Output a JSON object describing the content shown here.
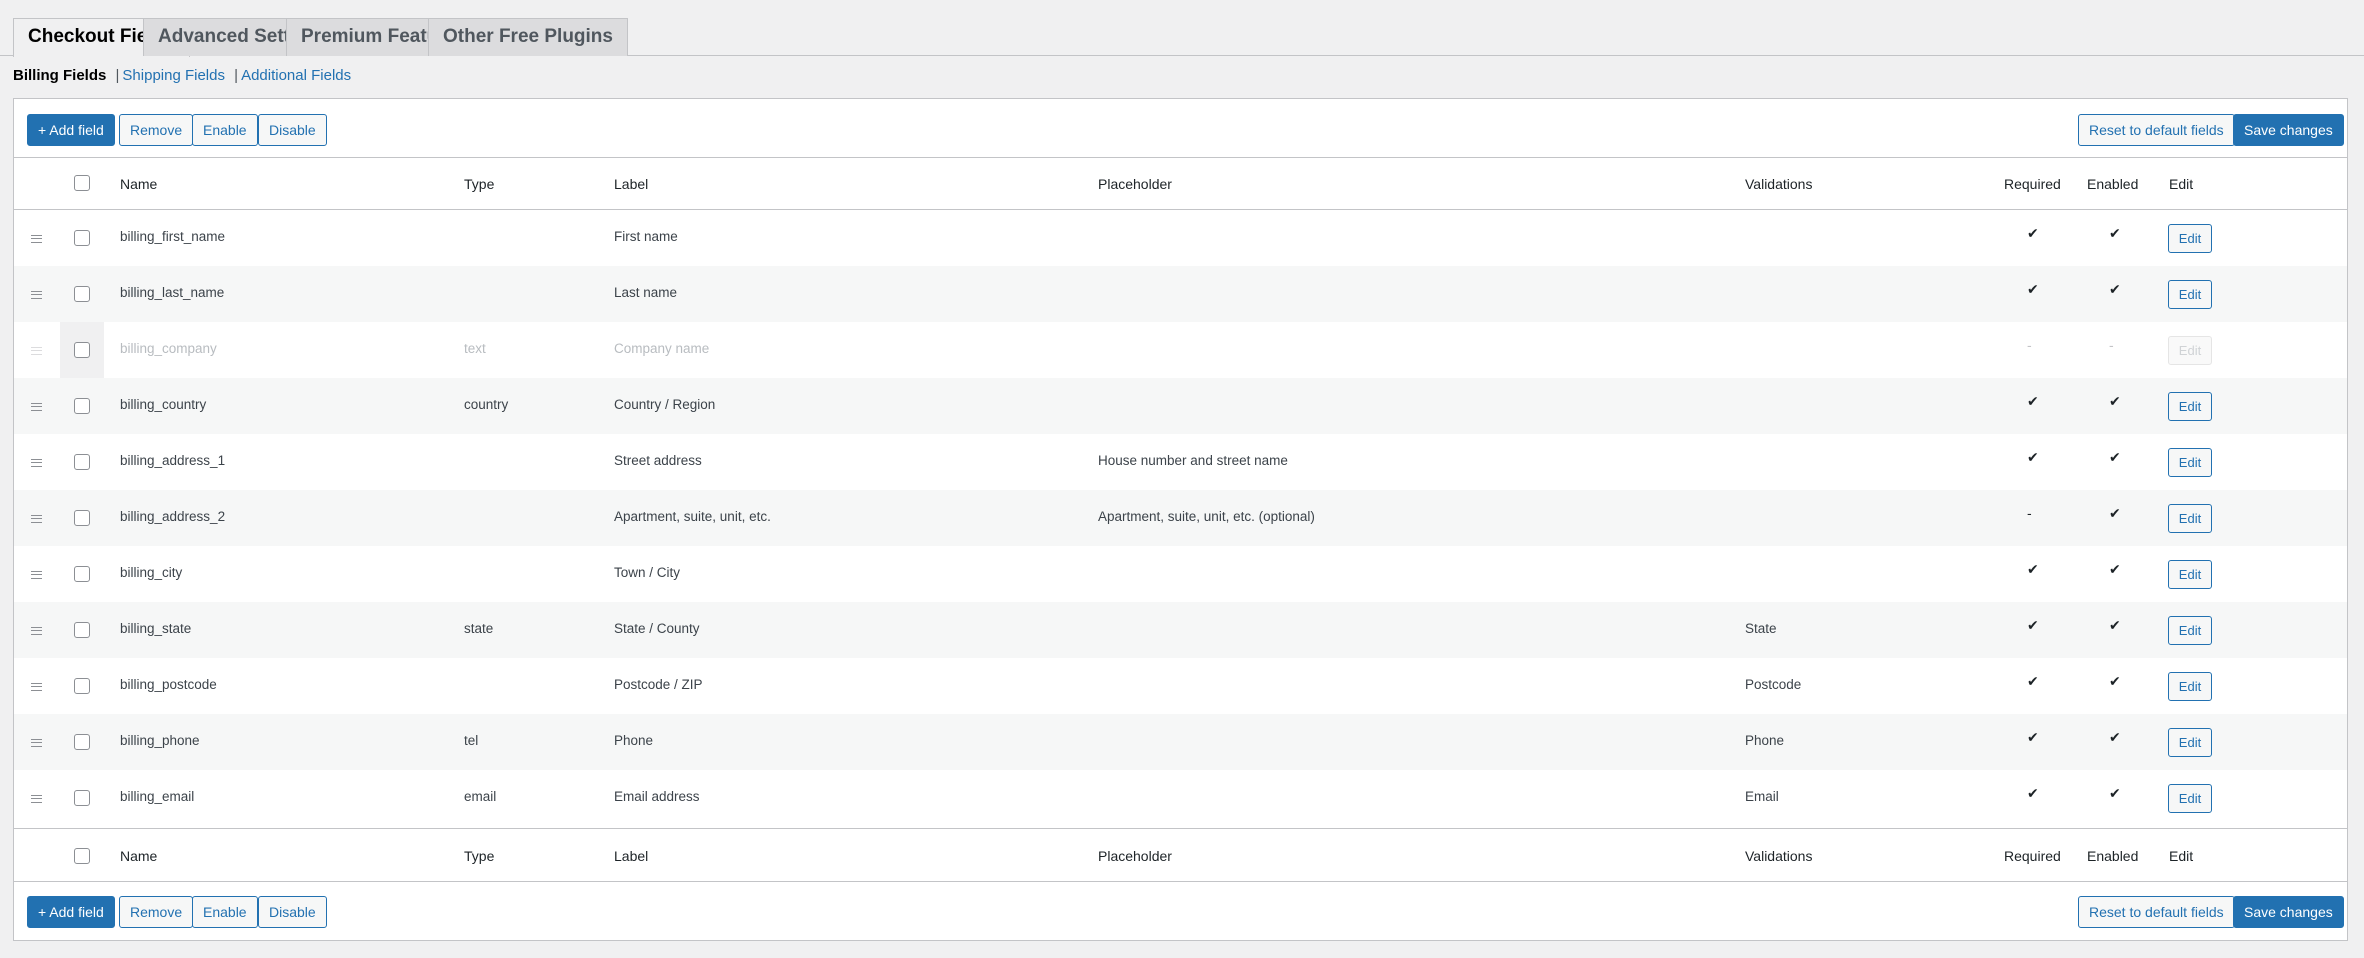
{
  "tabs": [
    "Checkout Fields",
    "Advanced Settings",
    "Premium Features",
    "Other Free Plugins"
  ],
  "subnav": {
    "current": "Billing Fields",
    "links": [
      "Shipping Fields",
      "Additional Fields"
    ],
    "separator": "|"
  },
  "toolbar": {
    "add": "+ Add field",
    "remove": "Remove",
    "enable": "Enable",
    "disable": "Disable",
    "reset": "Reset to default fields",
    "save": "Save changes"
  },
  "columns": {
    "name": "Name",
    "type": "Type",
    "label": "Label",
    "placeholder": "Placeholder",
    "validations": "Validations",
    "required": "Required",
    "enabled": "Enabled",
    "edit": "Edit"
  },
  "edit_label": "Edit",
  "rows": [
    {
      "name": "billing_first_name",
      "type": "",
      "label": "First name",
      "placeholder": "",
      "validations": "",
      "required": "✔",
      "enabled": "✔",
      "disabled": false
    },
    {
      "name": "billing_last_name",
      "type": "",
      "label": "Last name",
      "placeholder": "",
      "validations": "",
      "required": "✔",
      "enabled": "✔",
      "disabled": false
    },
    {
      "name": "billing_company",
      "type": "text",
      "label": "Company name",
      "placeholder": "",
      "validations": "",
      "required": "-",
      "enabled": "-",
      "disabled": true
    },
    {
      "name": "billing_country",
      "type": "country",
      "label": "Country / Region",
      "placeholder": "",
      "validations": "",
      "required": "✔",
      "enabled": "✔",
      "disabled": false
    },
    {
      "name": "billing_address_1",
      "type": "",
      "label": "Street address",
      "placeholder": "House number and street name",
      "validations": "",
      "required": "✔",
      "enabled": "✔",
      "disabled": false
    },
    {
      "name": "billing_address_2",
      "type": "",
      "label": "Apartment, suite, unit, etc.",
      "placeholder": "Apartment, suite, unit, etc. (optional)",
      "validations": "",
      "required": "-",
      "enabled": "✔",
      "disabled": false
    },
    {
      "name": "billing_city",
      "type": "",
      "label": "Town / City",
      "placeholder": "",
      "validations": "",
      "required": "✔",
      "enabled": "✔",
      "disabled": false
    },
    {
      "name": "billing_state",
      "type": "state",
      "label": "State / County",
      "placeholder": "",
      "validations": "State",
      "required": "✔",
      "enabled": "✔",
      "disabled": false
    },
    {
      "name": "billing_postcode",
      "type": "",
      "label": "Postcode / ZIP",
      "placeholder": "",
      "validations": "Postcode",
      "required": "✔",
      "enabled": "✔",
      "disabled": false
    },
    {
      "name": "billing_phone",
      "type": "tel",
      "label": "Phone",
      "placeholder": "",
      "validations": "Phone",
      "required": "✔",
      "enabled": "✔",
      "disabled": false
    },
    {
      "name": "billing_email",
      "type": "email",
      "label": "Email address",
      "placeholder": "",
      "validations": "Email",
      "required": "✔",
      "enabled": "✔",
      "disabled": false
    }
  ]
}
